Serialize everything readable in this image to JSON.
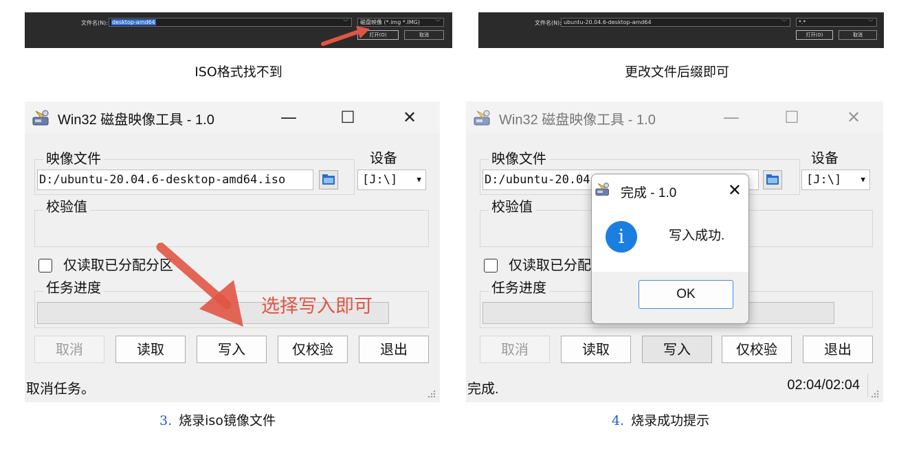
{
  "top_left": {
    "filename_label": "文件名(N):",
    "filename_value": "desktop-amd64",
    "filter_value": "磁盘映像 (*.img *.IMG)",
    "open_label": "打开(O)",
    "cancel_label": "取消",
    "caption": "ISO格式找不到"
  },
  "top_right": {
    "filename_label": "文件名(N):",
    "filename_value": "ubuntu-20.04.6-desktop-amd64",
    "filter_value": "*.*",
    "open_label": "打开(O)",
    "cancel_label": "取消",
    "caption": "更改文件后缀即可"
  },
  "left_window": {
    "title": "Win32 磁盘映像工具 - 1.0",
    "minimize": "—",
    "maximize": "☐",
    "close": "✕",
    "image_file_label": "映像文件",
    "image_path": "D:/ubuntu-20.04.6-desktop-amd64.iso",
    "device_label": "设备",
    "device_value": "[J:\\]",
    "hash_label": "校验值",
    "readonly_label": "仅读取已分配分区",
    "progress_label": "任务进度",
    "buttons": [
      "取消",
      "读取",
      "写入",
      "仅校验",
      "退出"
    ],
    "status": "取消任务。",
    "annotation": "选择写入即可"
  },
  "right_window": {
    "title": "Win32 磁盘映像工具 - 1.0",
    "minimize": "—",
    "maximize": "☐",
    "close": "✕",
    "image_file_label": "映像文件",
    "image_path": "D:/ubuntu-20.04.6-desktop-amd64.iso",
    "device_label": "设备",
    "device_value": "[J:\\]",
    "hash_label": "校验值",
    "readonly_label": "仅读取已分配分区",
    "progress_label": "任务进度",
    "buttons": [
      "取消",
      "读取",
      "写入",
      "仅校验",
      "退出"
    ],
    "status": "完成.",
    "elapsed": "02:04/02:04",
    "dialog": {
      "title": "完成 - 1.0",
      "close": "✕",
      "info_glyph": "i",
      "message": "写入成功.",
      "ok_label": "OK"
    }
  },
  "captions": {
    "left_number": "3.",
    "left_text": "烧录iso镜像文件",
    "right_number": "4.",
    "right_text": "烧录成功提示"
  },
  "colors": {
    "annotation_red": "#e05545",
    "info_blue": "#1b7fe0",
    "caption_number_blue": "#1f5fbf",
    "dark_dialog_bg": "#2b2b2b"
  }
}
